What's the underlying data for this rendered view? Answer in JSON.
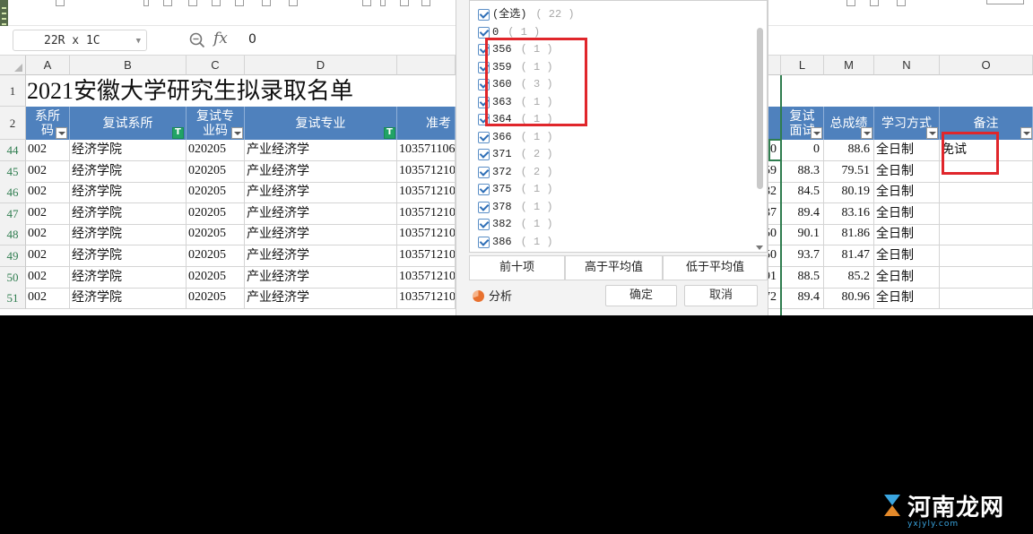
{
  "formula_bar": {
    "name_box": "22R x 1C",
    "fx_label": "fx",
    "value": "0"
  },
  "columns": [
    "A",
    "B",
    "C",
    "D",
    "L",
    "M",
    "N",
    "O"
  ],
  "title": "2021安徽大学研究生拟录取名单",
  "header": {
    "a": [
      "系所",
      "码"
    ],
    "b": "复试系所",
    "c": [
      "复试专",
      "业码"
    ],
    "d": "复试专业",
    "e": "准考",
    "l": [
      "复试",
      "面试"
    ],
    "m": "总成绩",
    "n": "学习方式",
    "o": "备注"
  },
  "rows": [
    {
      "num": "44",
      "a": "002",
      "b": "经济学院",
      "c": "020205",
      "d": "产业经济学",
      "e": "103571106",
      "k": "0",
      "l": "0",
      "m": "88.6",
      "n": "全日制",
      "o": "免试"
    },
    {
      "num": "45",
      "a": "002",
      "b": "经济学院",
      "c": "020205",
      "d": "产业经济学",
      "e": "103571210",
      "k": "59",
      "l": "88.3",
      "m": "79.51",
      "n": "全日制",
      "o": ""
    },
    {
      "num": "46",
      "a": "002",
      "b": "经济学院",
      "c": "020205",
      "d": "产业经济学",
      "e": "103571210",
      "k": "32",
      "l": "84.5",
      "m": "80.19",
      "n": "全日制",
      "o": ""
    },
    {
      "num": "47",
      "a": "002",
      "b": "经济学院",
      "c": "020205",
      "d": "产业经济学",
      "e": "103571210",
      "k": "37",
      "l": "89.4",
      "m": "83.16",
      "n": "全日制",
      "o": ""
    },
    {
      "num": "48",
      "a": "002",
      "b": "经济学院",
      "c": "020205",
      "d": "产业经济学",
      "e": "103571210",
      "k": "50",
      "l": "90.1",
      "m": "81.86",
      "n": "全日制",
      "o": ""
    },
    {
      "num": "49",
      "a": "002",
      "b": "经济学院",
      "c": "020205",
      "d": "产业经济学",
      "e": "103571210",
      "k": "50",
      "l": "93.7",
      "m": "81.47",
      "n": "全日制",
      "o": ""
    },
    {
      "num": "50",
      "a": "002",
      "b": "经济学院",
      "c": "020205",
      "d": "产业经济学",
      "e": "103571210",
      "k": "91",
      "l": "88.5",
      "m": "85.2",
      "n": "全日制",
      "o": ""
    },
    {
      "num": "51",
      "a": "002",
      "b": "经济学院",
      "c": "020205",
      "d": "产业经济学",
      "e": "103571210",
      "k": "72",
      "l": "89.4",
      "m": "80.96",
      "n": "全日制",
      "o": ""
    }
  ],
  "filter": {
    "items": [
      {
        "label": "(全选)",
        "count": "( 22 )"
      },
      {
        "label": "0",
        "count": "( 1 )"
      },
      {
        "label": "356",
        "count": "( 1 )"
      },
      {
        "label": "359",
        "count": "( 1 )"
      },
      {
        "label": "360",
        "count": "( 3 )"
      },
      {
        "label": "363",
        "count": "( 1 )"
      },
      {
        "label": "364",
        "count": "( 1 )"
      },
      {
        "label": "366",
        "count": "( 1 )"
      },
      {
        "label": "371",
        "count": "( 2 )"
      },
      {
        "label": "372",
        "count": "( 2 )"
      },
      {
        "label": "375",
        "count": "( 1 )"
      },
      {
        "label": "378",
        "count": "( 1 )"
      },
      {
        "label": "382",
        "count": "( 1 )"
      },
      {
        "label": "386",
        "count": "( 1 )"
      }
    ],
    "top_ten": "前十项",
    "above_avg": "高于平均值",
    "below_avg": "低于平均值",
    "analysis": "分析",
    "ok": "确定",
    "cancel": "取消"
  },
  "watermark": {
    "text": "河南龙网",
    "sub": "yxjyly.com"
  },
  "colors": {
    "header_blue": "#4f81bd",
    "select_green": "#2f7d4f",
    "highlight_red": "#e0262b"
  }
}
